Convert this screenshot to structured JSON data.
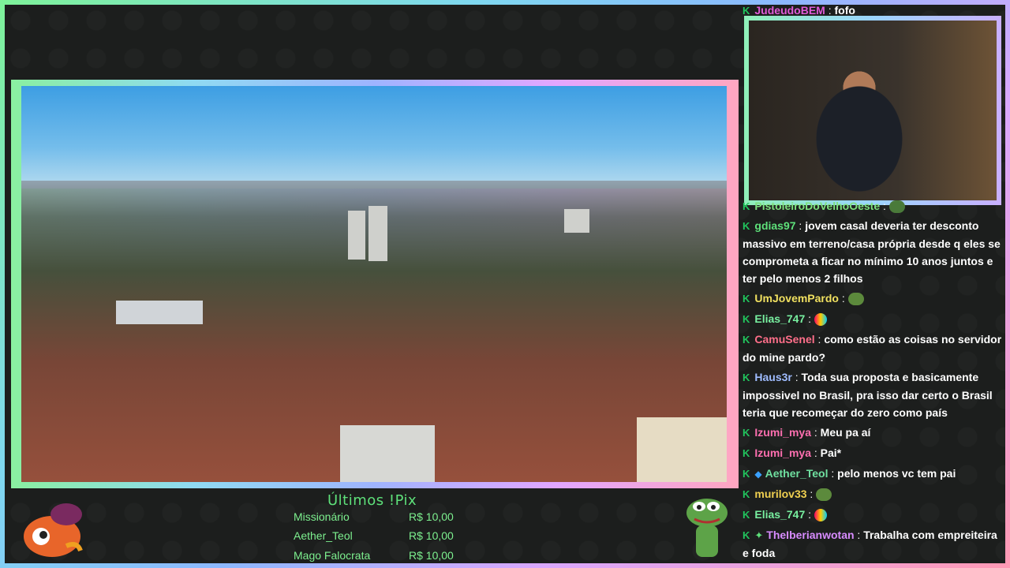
{
  "chat": [
    {
      "user": "JudeudoBEM",
      "color": "#e05ad8",
      "text": "fofo",
      "badge": "K"
    },
    {
      "user": "PistoleiroDoVelhoOeste",
      "color": "#7ee07e",
      "text": "",
      "badge": "K"
    },
    {
      "user": "gdias97",
      "color": "#5ee07a",
      "text": "jovem casal deveria ter desconto massivo em terreno/casa própria desde q eles se comprometa a ficar no mínimo 10 anos juntos e ter pelo menos 2 filhos",
      "badge": "K"
    },
    {
      "user": "UmJovemPardo",
      "color": "#f0e060",
      "text": "",
      "badge": "K"
    },
    {
      "user": "Elias_747",
      "color": "#78f0a0",
      "text": "",
      "badge": "K"
    },
    {
      "user": "CamuSenel",
      "color": "#ff6f8a",
      "text": "como estão as coisas no servidor do mine pardo?",
      "badge": "K"
    },
    {
      "user": "Haus3r",
      "color": "#9fbcff",
      "text": "Toda sua proposta e basicamente impossivel no Brasil, pra isso dar certo o Brasil teria que recomeçar do zero como país",
      "badge": "K"
    },
    {
      "user": "Izumi_mya",
      "color": "#ff6fb0",
      "text": "Meu pa aí",
      "badge": "K"
    },
    {
      "user": "Izumi_mya",
      "color": "#ff6fb0",
      "text": "Pai*",
      "badge": "K"
    },
    {
      "user": "Aether_Teol",
      "color": "#6fe0a0",
      "text": "pelo menos vc tem pai",
      "badge": "K"
    },
    {
      "user": "murilov33",
      "color": "#f0d050",
      "text": "",
      "badge": "K"
    },
    {
      "user": "Elias_747",
      "color": "#78f0a0",
      "text": "",
      "badge": "K"
    },
    {
      "user": "TheIberianwotan",
      "color": "#d88cff",
      "text": "Trabalha com empreiteira e foda",
      "badge": "K"
    }
  ],
  "pix": {
    "title": "Últimos !Pix",
    "rows": [
      {
        "name": "Missionário",
        "value": "R$ 10,00"
      },
      {
        "name": "Aether_Teol",
        "value": "R$ 10,00"
      },
      {
        "name": "Mago Falocrata",
        "value": "R$ 10,00"
      }
    ]
  },
  "icons": {
    "badge_color": "#21c55d"
  }
}
